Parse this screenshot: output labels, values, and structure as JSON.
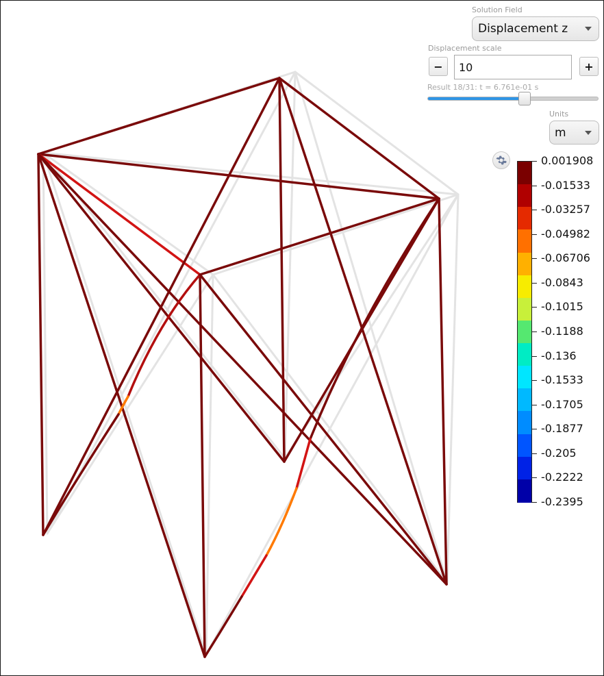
{
  "controls": {
    "solution_field_label": "Solution Field",
    "solution_field_value": "Displacement z",
    "displacement_scale_label": "Displacement scale",
    "minus_label": "−",
    "plus_label": "+",
    "scale_value": "10",
    "result_label": "Result 18/31: t = 6.761e-01 s",
    "result_progress": 0.567,
    "units_label": "Units",
    "units_value": "m"
  },
  "icons": {
    "settings": "gear-icon",
    "dropdown": "chevron-down-icon"
  },
  "legend": {
    "labels": [
      "0.001908",
      "-0.01533",
      "-0.03257",
      "-0.04982",
      "-0.06706",
      "-0.0843",
      "-0.1015",
      "-0.1188",
      "-0.136",
      "-0.1533",
      "-0.1705",
      "-0.1877",
      "-0.205",
      "-0.2222",
      "-0.2395"
    ],
    "colors": [
      "#7a0000",
      "#b00000",
      "#e52a00",
      "#ff7000",
      "#ffb000",
      "#f7ec00",
      "#c8f03a",
      "#55e870",
      "#00ecc4",
      "#00e6ff",
      "#00b9ff",
      "#008cff",
      "#0055ff",
      "#0022e6",
      "#0000a8"
    ]
  },
  "colors": {
    "member": "#7a0a0a",
    "member_light": "#b30f0f",
    "member_red": "#d21414",
    "member_orange": "#ff7a00",
    "ghost": "#e3e3e3"
  }
}
